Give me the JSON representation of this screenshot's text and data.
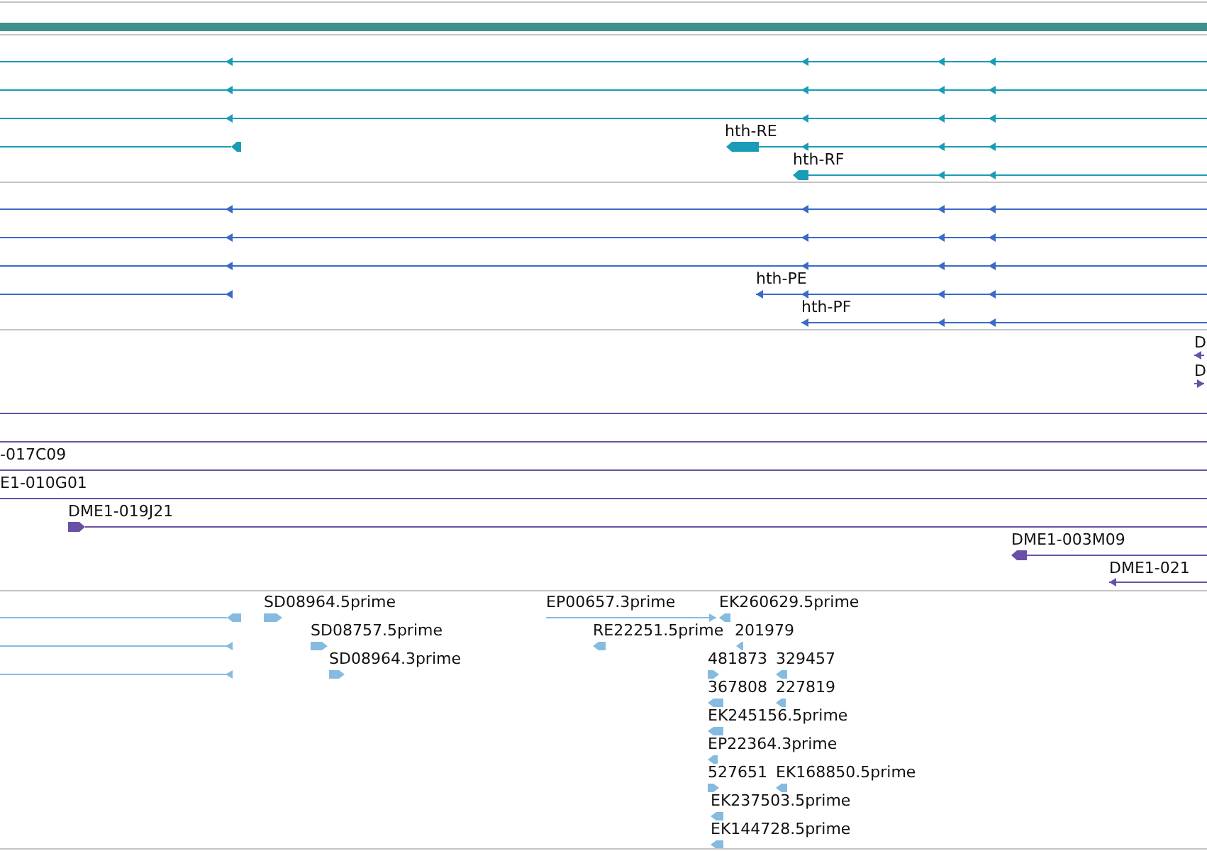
{
  "tracks": [
    {
      "kind": "transcripts",
      "color": "#1a9bb8",
      "labels": [
        "hth-RE",
        "hth-RF"
      ]
    },
    {
      "kind": "proteins",
      "color": "#3a6ac6",
      "labels": [
        "hth-PE",
        "hth-PF"
      ]
    },
    {
      "kind": "clones",
      "color": "#6a4fa8",
      "labels": [
        "D",
        "D",
        "-017C09",
        "E1-010G01",
        "DME1-019J21",
        "DME1-003M09",
        "DME1-021"
      ]
    },
    {
      "kind": "ests",
      "color": "#86bbe0",
      "labels": [
        "SD08964.5prime",
        "EP00657.3prime",
        "EK260629.5prime",
        "SD08757.5prime",
        "RE22251.5prime",
        "201979",
        "SD08964.3prime",
        "481873",
        "329457",
        "367808",
        "227819",
        "EK245156.5prime",
        "EP22364.3prime",
        "527651",
        "EK168850.5prime",
        "EK237503.5prime",
        "EK144728.5prime"
      ]
    }
  ]
}
